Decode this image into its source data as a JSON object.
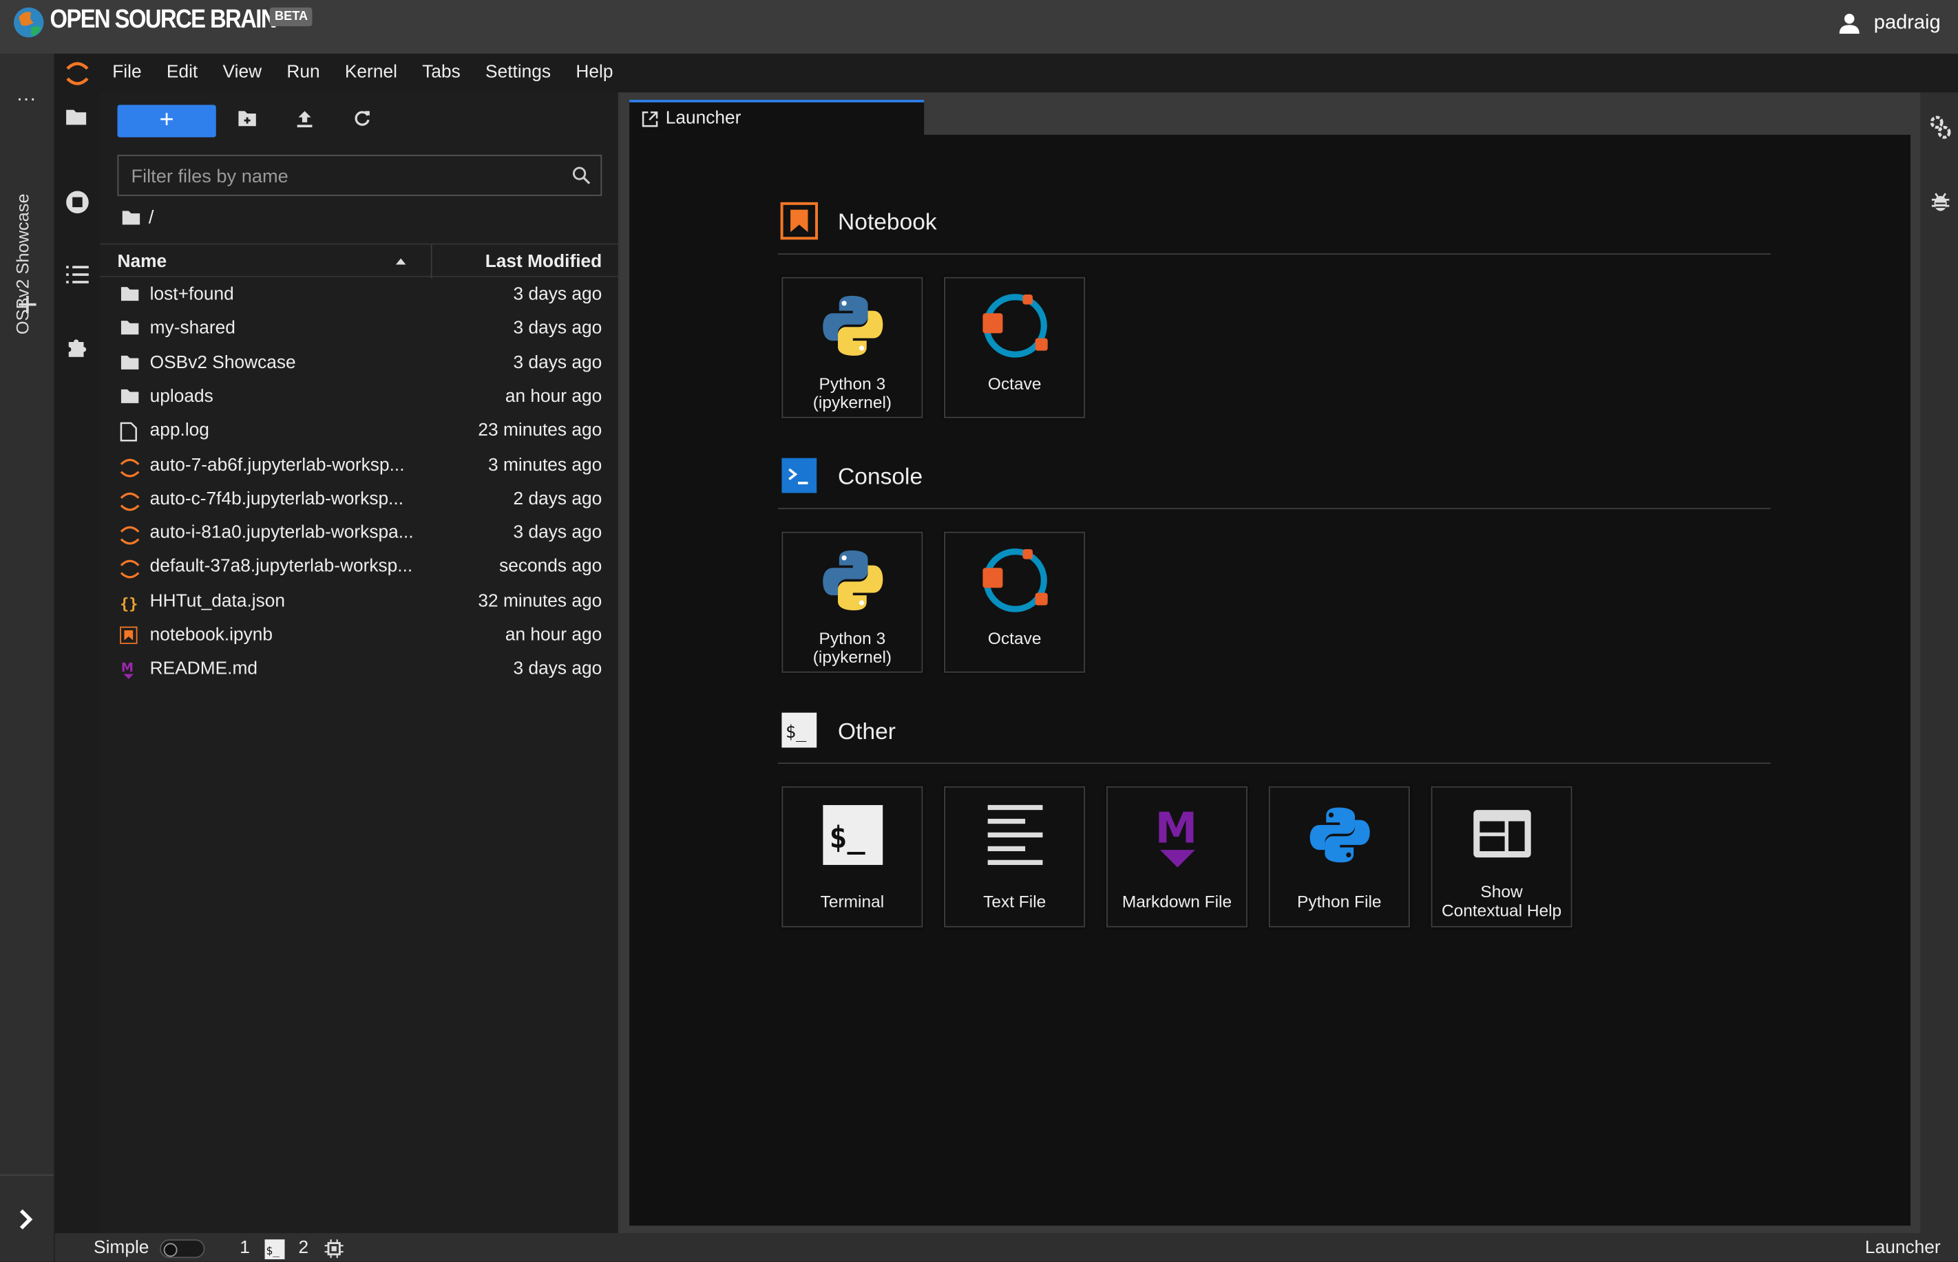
{
  "topbar": {
    "brand": "OPEN SOURCE BRAIN",
    "beta": "BETA",
    "user": "padraig"
  },
  "left_strip": {
    "vertical_tab": "OSBv2 Showcase"
  },
  "menu": [
    "File",
    "Edit",
    "View",
    "Run",
    "Kernel",
    "Tabs",
    "Settings",
    "Help"
  ],
  "filebrowser": {
    "new_button": "+",
    "filter_placeholder": "Filter files by name",
    "breadcrumb": "/",
    "col_name": "Name",
    "col_modified": "Last Modified",
    "files": [
      {
        "name": "lost+found",
        "modified": "3 days ago",
        "icon": "folder-icon"
      },
      {
        "name": "my-shared",
        "modified": "3 days ago",
        "icon": "folder-icon"
      },
      {
        "name": "OSBv2 Showcase",
        "modified": "3 days ago",
        "icon": "folder-icon"
      },
      {
        "name": "uploads",
        "modified": "an hour ago",
        "icon": "folder-icon"
      },
      {
        "name": "app.log",
        "modified": "23 minutes ago",
        "icon": "file-icon"
      },
      {
        "name": "auto-7-ab6f.jupyterlab-worksp...",
        "modified": "3 minutes ago",
        "icon": "jupyter-icon"
      },
      {
        "name": "auto-c-7f4b.jupyterlab-worksp...",
        "modified": "2 days ago",
        "icon": "jupyter-icon"
      },
      {
        "name": "auto-i-81a0.jupyterlab-workspa...",
        "modified": "3 days ago",
        "icon": "jupyter-icon"
      },
      {
        "name": "default-37a8.jupyterlab-worksp...",
        "modified": "seconds ago",
        "icon": "jupyter-icon"
      },
      {
        "name": "HHTut_data.json",
        "modified": "32 minutes ago",
        "icon": "json-icon"
      },
      {
        "name": "notebook.ipynb",
        "modified": "an hour ago",
        "icon": "notebook-icon"
      },
      {
        "name": "README.md",
        "modified": "3 days ago",
        "icon": "markdown-icon"
      }
    ]
  },
  "tab": {
    "label": "Launcher"
  },
  "launcher": {
    "notebook": {
      "title": "Notebook",
      "cards": [
        {
          "label": "Python 3 (ipykernel)"
        },
        {
          "label": "Octave"
        }
      ]
    },
    "console": {
      "title": "Console",
      "cards": [
        {
          "label": "Python 3 (ipykernel)"
        },
        {
          "label": "Octave"
        }
      ]
    },
    "other": {
      "title": "Other",
      "cards": [
        {
          "label": "Terminal"
        },
        {
          "label": "Text File"
        },
        {
          "label": "Markdown File"
        },
        {
          "label": "Python File"
        },
        {
          "label": "Show Contextual Help"
        }
      ]
    }
  },
  "statusbar": {
    "mode": "Simple",
    "kernels": "1",
    "terminals": "2",
    "right": "Launcher"
  },
  "colors": {
    "accent": "#2f80ed",
    "jupyter_orange": "#f37726",
    "markdown_purple": "#7b1fa2"
  }
}
